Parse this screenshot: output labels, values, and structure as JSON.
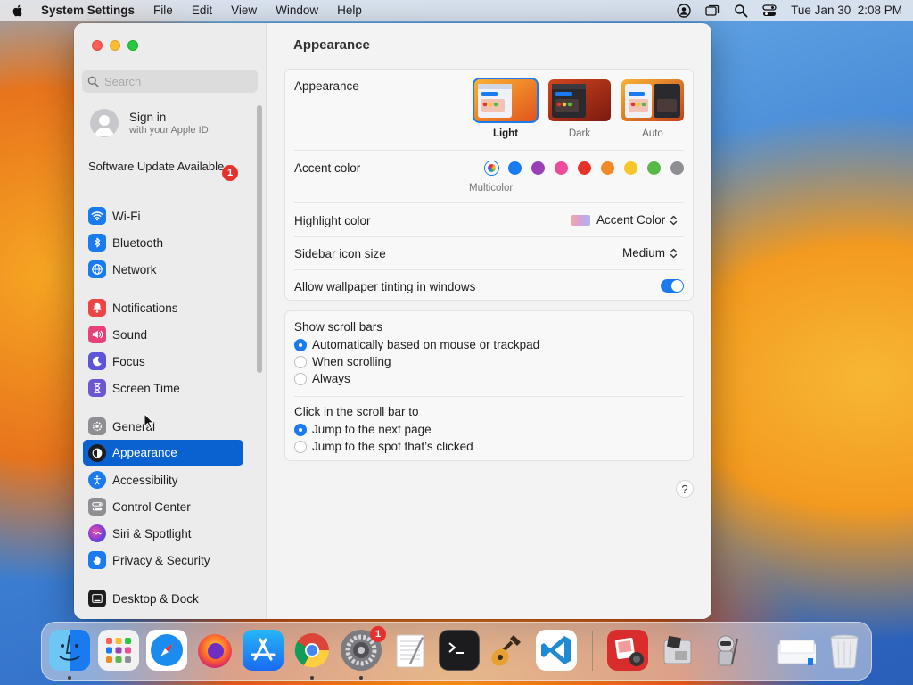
{
  "menubar": {
    "app_name": "System Settings",
    "menus": [
      "File",
      "Edit",
      "View",
      "Window",
      "Help"
    ],
    "datetime": "Tue Jan 30  2:08 PM"
  },
  "sidebar": {
    "search_placeholder": "Search",
    "signin_title": "Sign in",
    "signin_subtitle": "with your Apple ID",
    "update_label": "Software Update Available",
    "update_badge": "1",
    "items": [
      {
        "label": "Wi-Fi",
        "icon": "wifi-icon",
        "color": "#1a7af0"
      },
      {
        "label": "Bluetooth",
        "icon": "bluetooth-icon",
        "color": "#1a7af0"
      },
      {
        "label": "Network",
        "icon": "globe-icon",
        "color": "#1a7af0"
      },
      {
        "label": "Notifications",
        "icon": "bell-icon",
        "color": "#ec4545"
      },
      {
        "label": "Sound",
        "icon": "speaker-icon",
        "color": "#e9407a"
      },
      {
        "label": "Focus",
        "icon": "moon-icon",
        "color": "#5d55d8"
      },
      {
        "label": "Screen Time",
        "icon": "hourglass-icon",
        "color": "#6e56cf"
      },
      {
        "label": "General",
        "icon": "gear-icon",
        "color": "#8e8e93"
      },
      {
        "label": "Appearance",
        "icon": "appearance-icon",
        "color": "#1d1d1f"
      },
      {
        "label": "Accessibility",
        "icon": "accessibility-icon",
        "color": "#1a7af0"
      },
      {
        "label": "Control Center",
        "icon": "control-center-icon",
        "color": "#8e8e93"
      },
      {
        "label": "Siri & Spotlight",
        "icon": "siri-icon",
        "color": "#b34fd6"
      },
      {
        "label": "Privacy & Security",
        "icon": "hand-icon",
        "color": "#1a7af0"
      },
      {
        "label": "Desktop & Dock",
        "icon": "dock-icon",
        "color": "#1d1d1f"
      }
    ]
  },
  "content": {
    "title": "Appearance",
    "appearance_label": "Appearance",
    "appearance_options": [
      {
        "label": "Light",
        "selected": true
      },
      {
        "label": "Dark",
        "selected": false
      },
      {
        "label": "Auto",
        "selected": false
      }
    ],
    "accent_label": "Accent color",
    "accent_colors": [
      "multicolor",
      "#1a7af0",
      "#9a3fb5",
      "#ec4c9a",
      "#e5322d",
      "#f18a24",
      "#f8c62a",
      "#5ab84a",
      "#8e8e93"
    ],
    "accent_caption": "Multicolor",
    "highlight_label": "Highlight color",
    "highlight_value": "Accent Color",
    "icon_size_label": "Sidebar icon size",
    "icon_size_value": "Medium",
    "tinting_label": "Allow wallpaper tinting in windows",
    "tinting_on": true,
    "scrollbars_label": "Show scroll bars",
    "scrollbars_options": [
      {
        "label": "Automatically based on mouse or trackpad",
        "selected": true
      },
      {
        "label": "When scrolling",
        "selected": false
      },
      {
        "label": "Always",
        "selected": false
      }
    ],
    "click_label": "Click in the scroll bar to",
    "click_options": [
      {
        "label": "Jump to the next page",
        "selected": true
      },
      {
        "label": "Jump to the spot that’s clicked",
        "selected": false
      }
    ],
    "help_label": "?"
  },
  "dock": {
    "apps": [
      "Finder",
      "Launchpad",
      "Safari",
      "Firefox",
      "App Store",
      "Chrome",
      "System Settings",
      "TextEdit",
      "Terminal",
      "GarageBand",
      "Visual Studio Code",
      "Photo Booth",
      "Boot Camp Assistant",
      "Automator",
      "Downloads",
      "Trash"
    ],
    "settings_badge": "1"
  }
}
